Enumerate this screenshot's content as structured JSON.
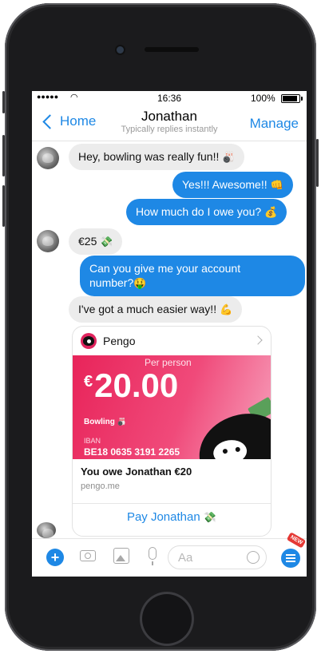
{
  "status": {
    "time": "16:36",
    "battery": "100%",
    "battery_level": 1.0
  },
  "nav": {
    "back_label": "Home",
    "title": "Jonathan",
    "subtitle": "Typically replies instantly",
    "manage_label": "Manage"
  },
  "messages": [
    {
      "dir": "in",
      "text": "Hey, bowling was really fun!!",
      "emoji": "🎳"
    },
    {
      "dir": "out",
      "text": "Yes!!! Awesome!!",
      "emoji": "👊"
    },
    {
      "dir": "out",
      "text": "How much do I owe you?",
      "emoji": "💰"
    },
    {
      "dir": "in",
      "text": "€25",
      "emoji": "💸"
    },
    {
      "dir": "out",
      "text": "Can you give me your account",
      "text2": "number?",
      "emoji": "🤑"
    },
    {
      "dir": "in",
      "text": "I've got a much easier way!!",
      "emoji": "💪"
    }
  ],
  "card": {
    "brand": "Pengo",
    "per_person": "Per person",
    "currency": "€",
    "amount": "20.00",
    "event": "Bowling",
    "event_emoji": "🎳",
    "iban_label": "IBAN",
    "iban": "BE18 0635 3191 2265",
    "title": "You owe Jonathan €20",
    "url": "pengo.me",
    "action": "Pay Jonathan",
    "action_emoji": "💸"
  },
  "composer": {
    "placeholder": "Aa",
    "badge": "NEW"
  }
}
